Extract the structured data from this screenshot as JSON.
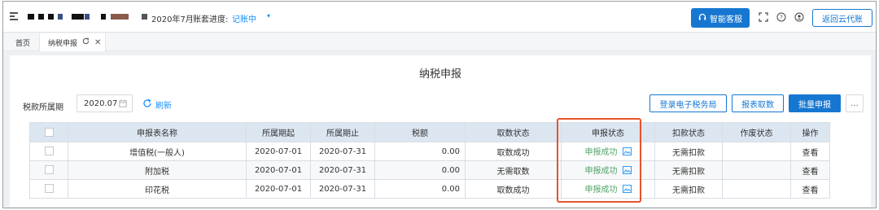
{
  "header": {
    "period_text": "2020年7月",
    "progress_label": "账套进度:",
    "progress_value": "记账中",
    "service_button": "智能客服",
    "back_button": "返回云代账"
  },
  "tabs": [
    {
      "label": "首页"
    },
    {
      "label": "纳税申报"
    }
  ],
  "page": {
    "title": "纳税申报",
    "period_label": "税款所属期",
    "period_value": "2020.07",
    "refresh_label": "刷新"
  },
  "actions": {
    "login_etax": "登录电子税务局",
    "fetch_reports": "报表取数",
    "batch_declare": "批量申报",
    "more": "..."
  },
  "table": {
    "headers": [
      "申报表名称",
      "所属期起",
      "所属期止",
      "税额",
      "取数状态",
      "申报状态",
      "扣款状态",
      "作废状态",
      "操作"
    ],
    "rows": [
      {
        "name": "增值税(一般人)",
        "start": "2020-07-01",
        "end": "2020-07-31",
        "tax": "0.00",
        "fetch_status": "取数成功",
        "declare_status": "申报成功",
        "deduct_status": "无需扣款",
        "void_status": "",
        "action": "查看"
      },
      {
        "name": "附加税",
        "start": "2020-07-01",
        "end": "2020-07-31",
        "tax": "0.00",
        "fetch_status": "无需取数",
        "declare_status": "申报成功",
        "deduct_status": "无需扣款",
        "void_status": "",
        "action": "查看"
      },
      {
        "name": "印花税",
        "start": "2020-07-01",
        "end": "2020-07-31",
        "tax": "0.00",
        "fetch_status": "取数成功",
        "declare_status": "申报成功",
        "deduct_status": "无需扣款",
        "void_status": "",
        "action": "查看"
      }
    ]
  },
  "colors": {
    "primary": "#1677d2",
    "link": "#1890ff",
    "success": "#52a36b",
    "highlight": "#e8532c",
    "table_header": "#dce6f1"
  },
  "icons": [
    "menu-icon",
    "headset-icon",
    "fullscreen-icon",
    "help-icon",
    "user-icon",
    "refresh-icon",
    "calendar-icon",
    "close-icon",
    "image-icon"
  ]
}
